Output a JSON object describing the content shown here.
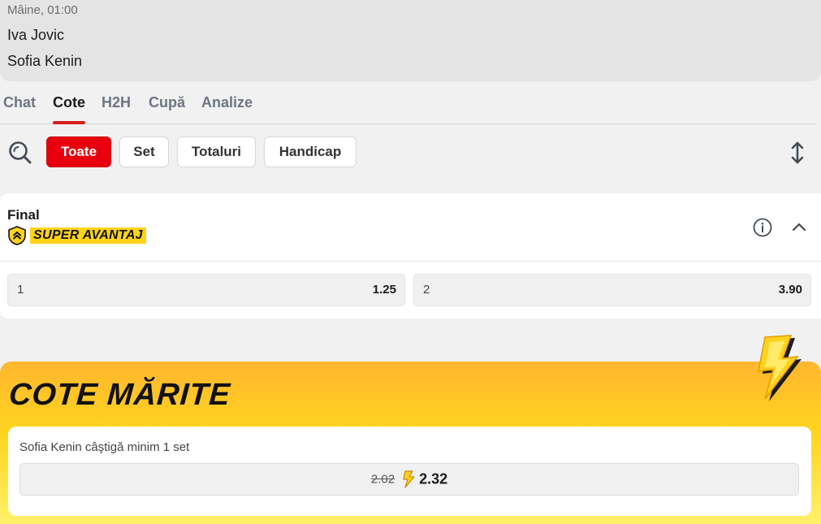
{
  "match": {
    "time": "Mâine, 01:00",
    "player1": "Iva Jovic",
    "player2": "Sofia Kenin"
  },
  "tabs": [
    {
      "label": "Chat",
      "active": false
    },
    {
      "label": "Cote",
      "active": true
    },
    {
      "label": "H2H",
      "active": false
    },
    {
      "label": "Cupă",
      "active": false
    },
    {
      "label": "Analize",
      "active": false
    }
  ],
  "filters": {
    "chips": [
      {
        "label": "Toate",
        "active": true
      },
      {
        "label": "Set",
        "active": false
      },
      {
        "label": "Totaluri",
        "active": false
      },
      {
        "label": "Handicap",
        "active": false
      }
    ],
    "icons": [
      "search-icon",
      "expand-collapse-icon"
    ]
  },
  "market": {
    "title": "Final",
    "badge": "SUPER AVANTAJ",
    "icons": [
      "info-icon",
      "chevron-up-icon"
    ],
    "odds": [
      {
        "label": "1",
        "value": "1.25"
      },
      {
        "label": "2",
        "value": "3.90"
      }
    ]
  },
  "boost": {
    "title": "COTE MĂRITE",
    "description": "Sofia Kenin câştigă minim 1 set",
    "old_odd": "2.02",
    "new_odd": "2.32"
  },
  "colors": {
    "accent_red": "#e8000e",
    "badge_yellow": "#ffd31a",
    "boost_gradient_top": "#ffb62e",
    "boost_gradient_bottom": "#fff06a"
  }
}
